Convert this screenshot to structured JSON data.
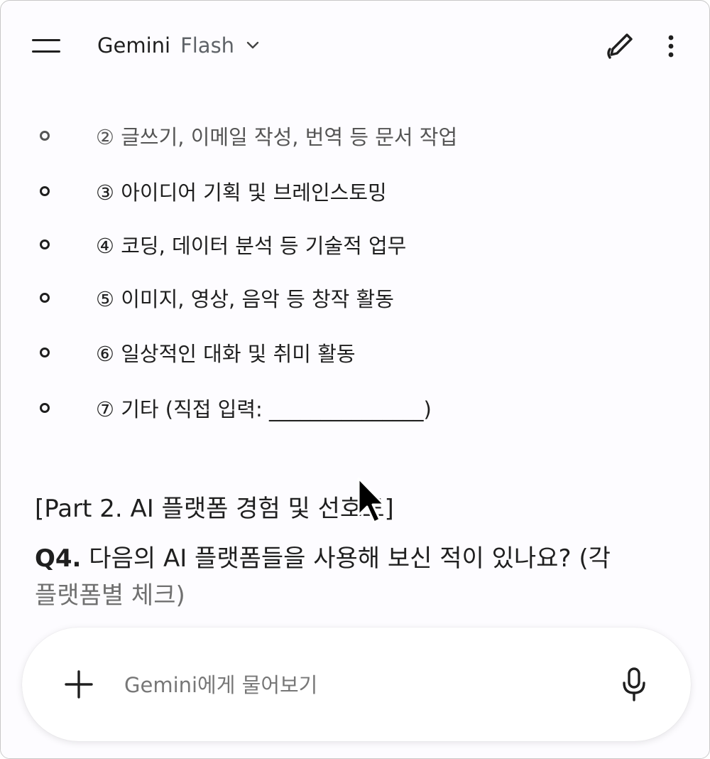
{
  "header": {
    "app_name": "Gemini",
    "model_name": "Flash",
    "icons": {
      "menu": "menu-icon",
      "model_dropdown": "chevron-down-icon",
      "new_chat": "edit-pen-icon",
      "more": "more-vert-icon"
    }
  },
  "options": [
    "② 글쓰기, 이메일 작성, 번역 등 문서 작업",
    "③ 아이디어 기획 및 브레인스토밍",
    "④ 코딩, 데이터 분석 등 기술적 업무",
    "⑤ 이미지, 영상, 음악 등 창작 활동",
    "⑥ 일상적인 대화 및 취미 활동",
    "⑦ 기타 (직접 입력: _______________)"
  ],
  "section_heading": "[Part 2. AI 플랫폼 경험 및 선호도]",
  "question": {
    "number": "Q4.",
    "text_line1": " 다음의 AI 플랫폼들을 사용해 보신 적이 있나요? (각",
    "text_line2": "플랫폼별 체크)"
  },
  "input": {
    "placeholder": "Gemini에게 물어보기",
    "icons": {
      "add": "plus-icon",
      "voice": "mic-icon"
    }
  },
  "colors": {
    "background": "#fdfcff",
    "text": "#1f1f1f",
    "muted": "#5f6368"
  }
}
